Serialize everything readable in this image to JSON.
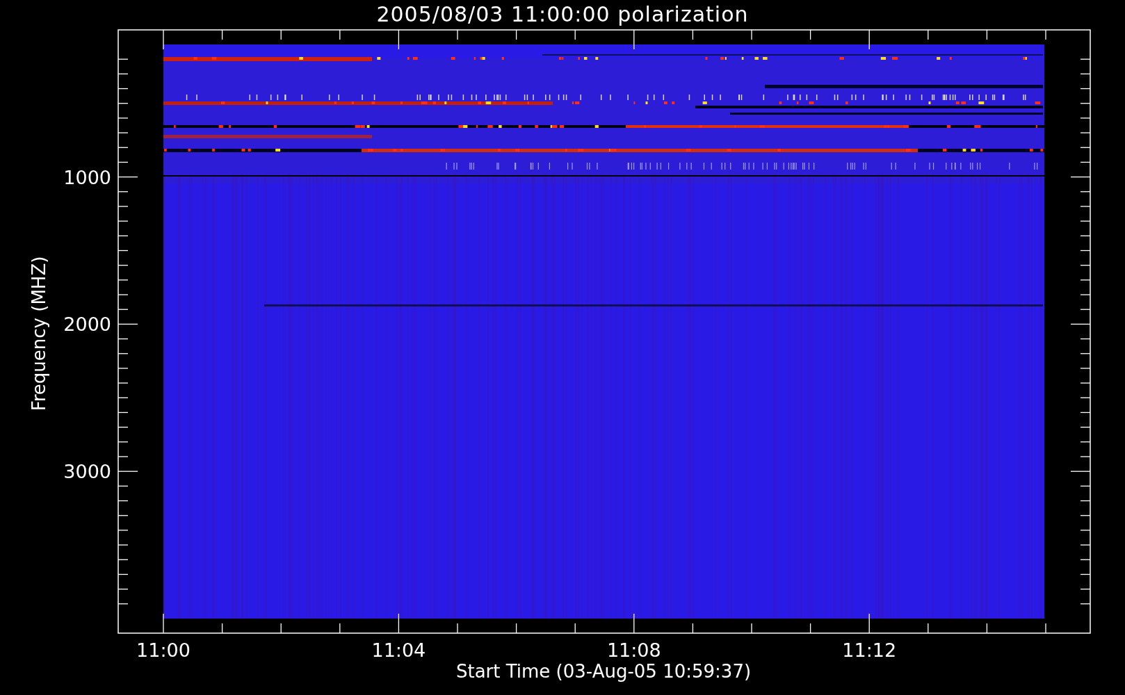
{
  "title": "2005/08/03 11:00:00 polarization",
  "plot": {
    "ylabel": "Frequency (MHZ)",
    "xlabel": "Start Time (03-Aug-05 10:59:37)",
    "yticks": [
      "1000",
      "2000",
      "3000"
    ],
    "xticks": [
      "11:00",
      "11:04",
      "11:08",
      "11:12"
    ]
  }
}
